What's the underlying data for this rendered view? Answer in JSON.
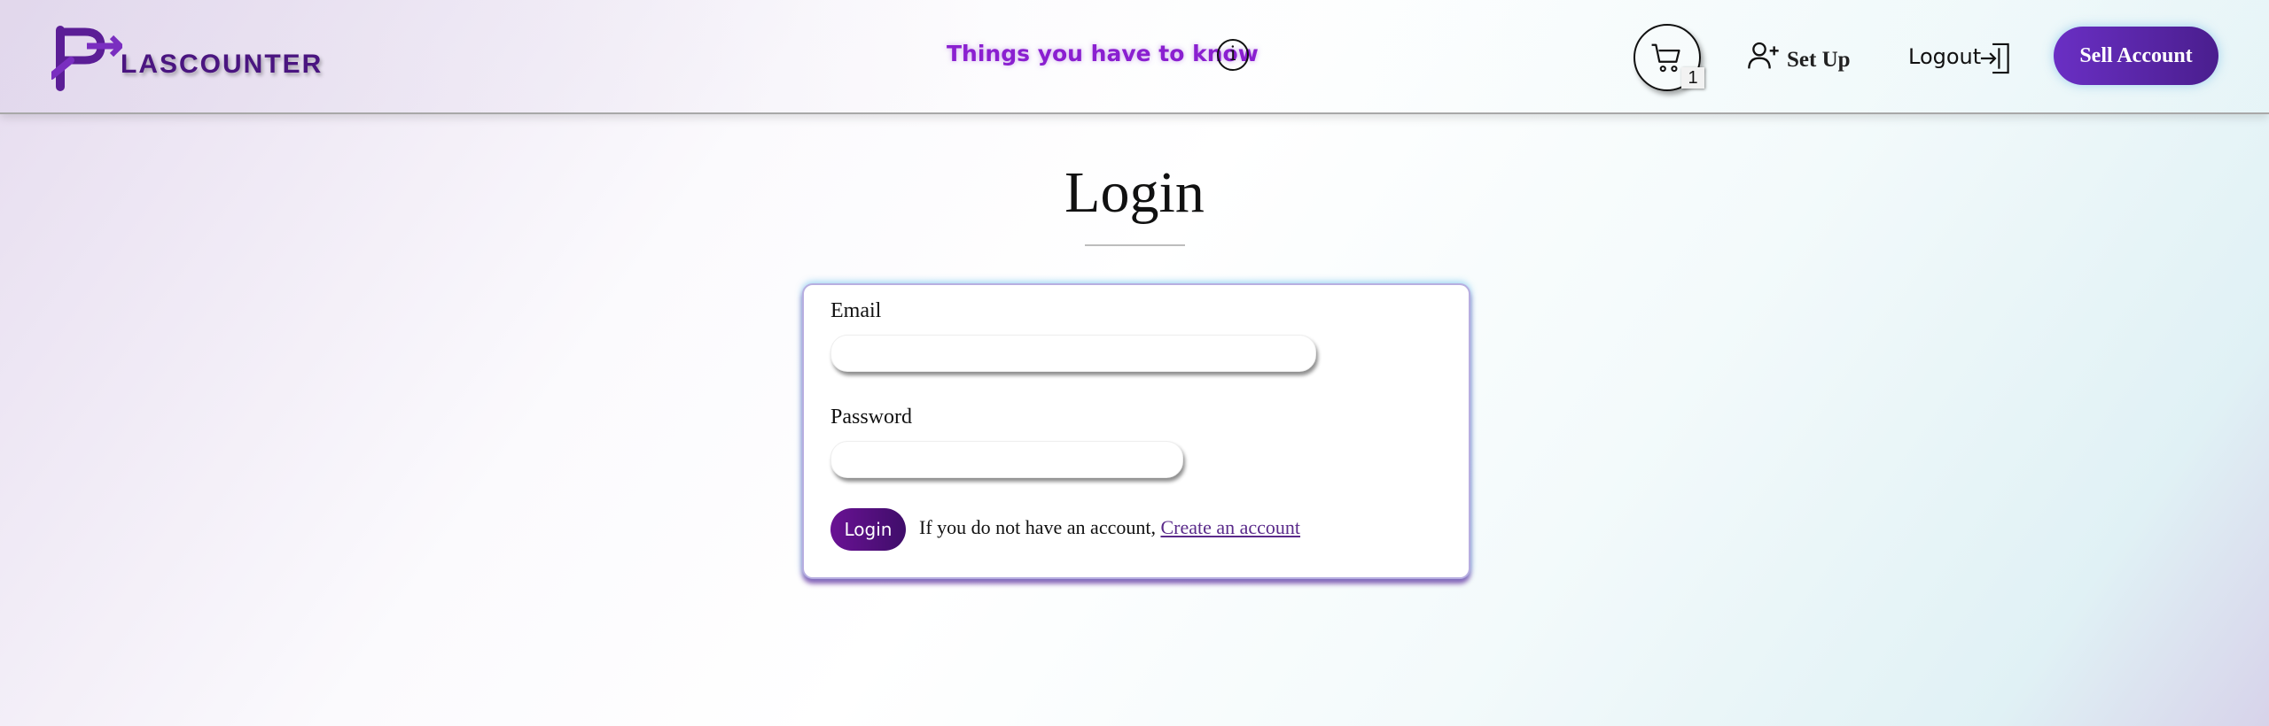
{
  "header": {
    "logo_text": "LASCOUNTER",
    "things_link": "Things you have to know",
    "info_icon": "info-icon",
    "cart_count": "1",
    "setup_label": "Set Up",
    "logout_label": "Logout",
    "sell_label": "Sell Account"
  },
  "main": {
    "title": "Login",
    "email_label": "Email",
    "email_value": "",
    "password_label": "Password",
    "password_value": "",
    "login_button": "Login",
    "account_note": "If you do not have an account,",
    "create_link": "Create an account"
  },
  "colors": {
    "brand_purple": "#4a1580",
    "accent_purple": "#8a1fd0",
    "button_purple": "#6a2fc4"
  }
}
